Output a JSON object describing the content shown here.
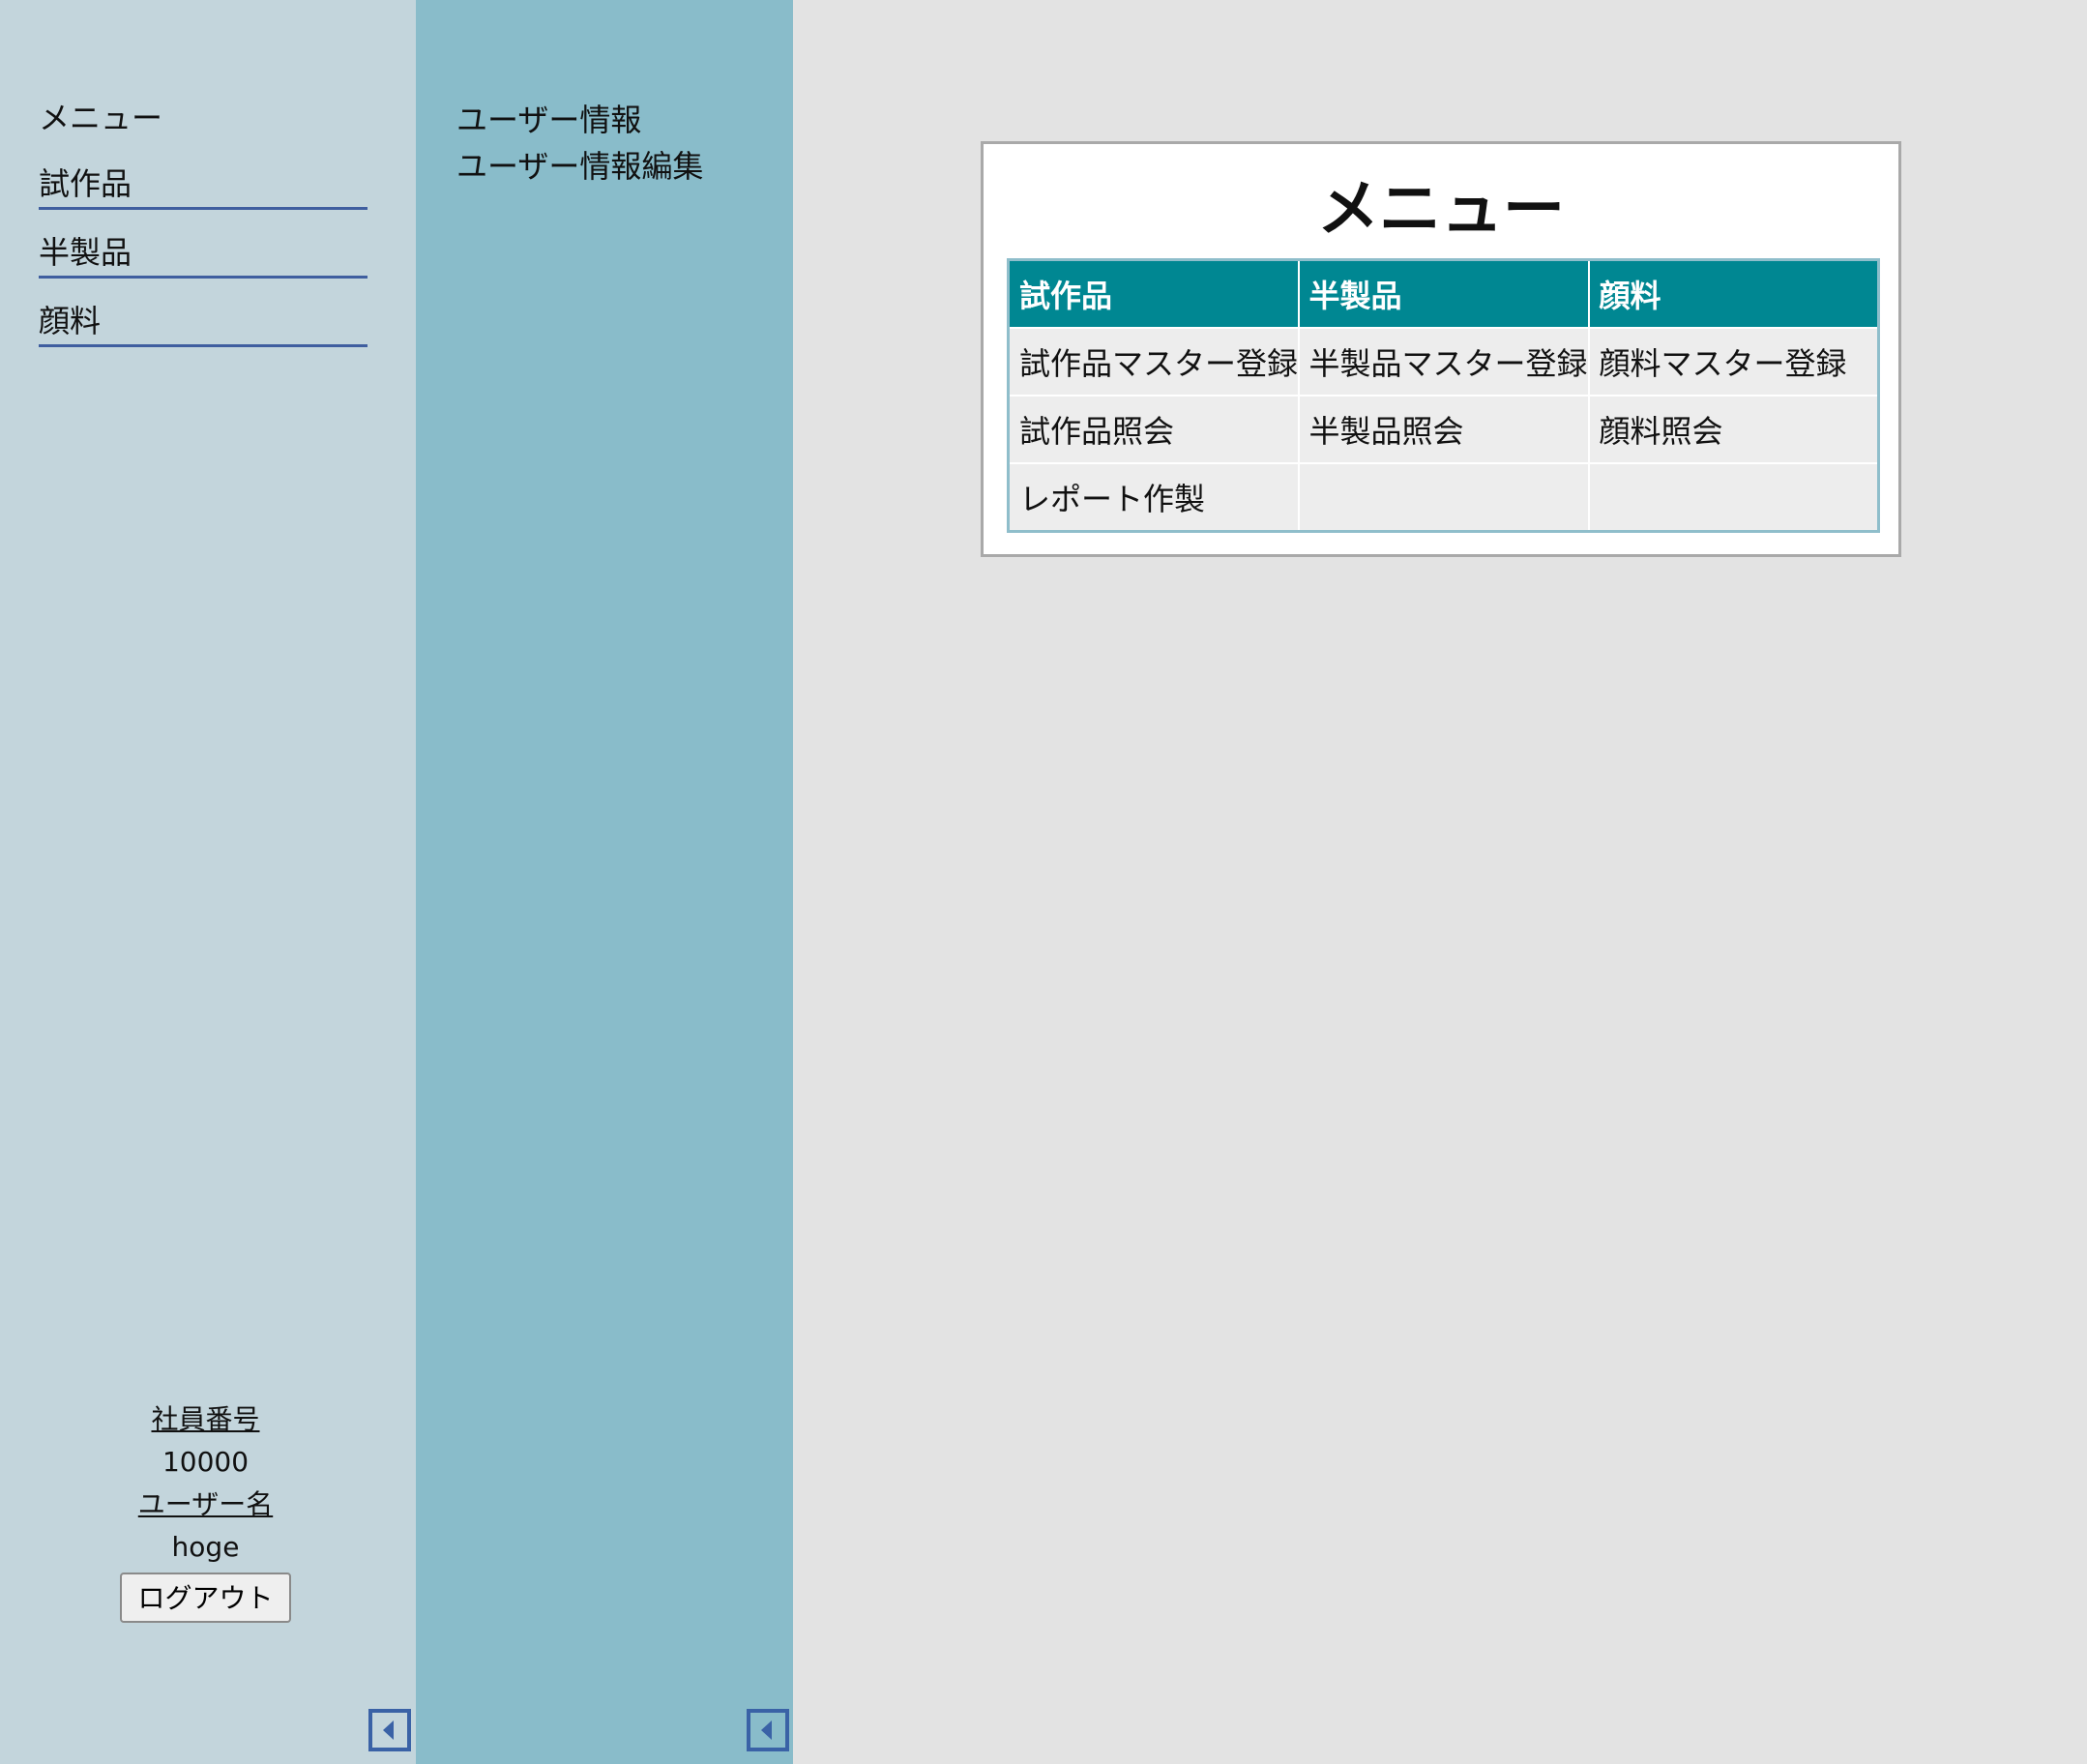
{
  "sidebar": {
    "title": "メニュー",
    "items": [
      {
        "label": "試作品"
      },
      {
        "label": "半製品"
      },
      {
        "label": "顔料"
      }
    ],
    "user": {
      "employee_no_label": "社員番号",
      "employee_no": "10000",
      "username_label": "ユーザー名",
      "username": "hoge",
      "logout_label": "ログアウト"
    },
    "collapse_icon": "chevron-left-icon"
  },
  "subnav": {
    "items": [
      {
        "label": "ユーザー情報"
      },
      {
        "label": "ユーザー情報編集"
      }
    ],
    "collapse_icon": "chevron-left-icon"
  },
  "main": {
    "title": "メニュー",
    "table": {
      "headers": [
        "試作品",
        "半製品",
        "顔料"
      ],
      "rows": [
        [
          "試作品マスター登録",
          "半製品マスター登録",
          "顔料マスター登録"
        ],
        [
          "試作品照会",
          "半製品照会",
          "顔料照会"
        ],
        [
          "レポート作製",
          "",
          ""
        ]
      ]
    }
  },
  "colors": {
    "sidebar_bg": "#c3d5dc",
    "subnav_bg": "#89bcca",
    "table_header_bg": "#008792",
    "nav_underline": "#3f5e9f"
  }
}
